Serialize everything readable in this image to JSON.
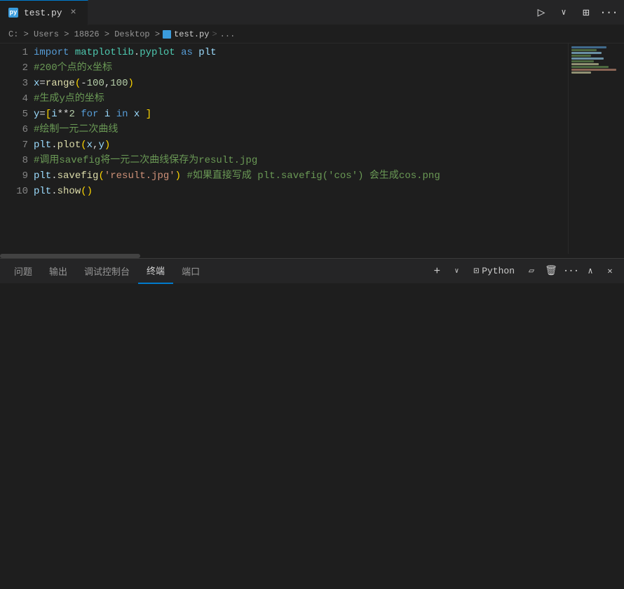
{
  "tab": {
    "icon": "py",
    "label": "test.py",
    "close_label": "×"
  },
  "toolbar": {
    "run_title": "Run Python File",
    "split_title": "Split Editor",
    "more_title": "More Actions"
  },
  "breadcrumb": {
    "path": "C: > Users > 18826 > Desktop >",
    "file": "test.py",
    "more": "..."
  },
  "code": {
    "lines": [
      {
        "num": 1,
        "content": "import matplotlib.pyplot as plt"
      },
      {
        "num": 2,
        "content": "#200个点的x坐标"
      },
      {
        "num": 3,
        "content": "x=range(-100,100)"
      },
      {
        "num": 4,
        "content": "#生成y点的坐标"
      },
      {
        "num": 5,
        "content": "y=[i**2 for i in x ]"
      },
      {
        "num": 6,
        "content": "#绘制一元二次曲线"
      },
      {
        "num": 7,
        "content": "plt.plot(x,y)"
      },
      {
        "num": 8,
        "content": "#调用savefig将一元二次曲线保存为result.jpg"
      },
      {
        "num": 9,
        "content": "plt.savefig('result.jpg') #如果直接写成 plt.savefig('cos') 会生成cos.png"
      },
      {
        "num": 10,
        "content": "plt.show()"
      }
    ]
  },
  "panel": {
    "tabs": [
      {
        "label": "问题",
        "active": false
      },
      {
        "label": "输出",
        "active": false
      },
      {
        "label": "调试控制台",
        "active": false
      },
      {
        "label": "终端",
        "active": true
      },
      {
        "label": "端口",
        "active": false
      }
    ],
    "python_label": "Python",
    "actions": {
      "new_terminal": "+",
      "kill_terminal": "trash",
      "more": "···",
      "maximize": "maximize",
      "close": "✕"
    }
  }
}
